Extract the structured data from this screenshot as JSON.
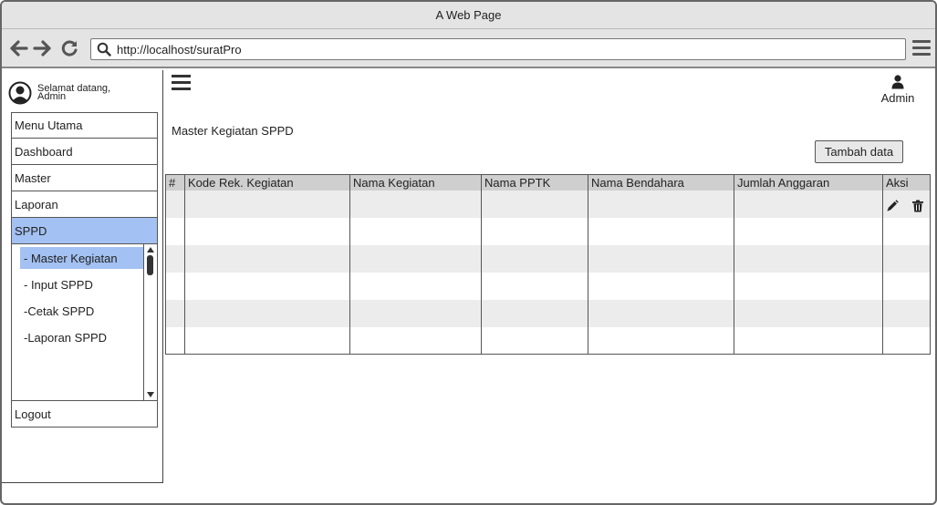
{
  "window": {
    "title": "A Web Page"
  },
  "browser": {
    "url": "http://localhost/suratPro"
  },
  "sidebar": {
    "welcome_line1": "Selamat datang,",
    "welcome_line2": "Admin",
    "items": [
      {
        "label": "Menu Utama"
      },
      {
        "label": "Dashboard"
      },
      {
        "label": "Master"
      },
      {
        "label": "Laporan"
      },
      {
        "label": "SPPD"
      }
    ],
    "submenu": [
      {
        "label": "- Master Kegiatan"
      },
      {
        "label": "- Input SPPD"
      },
      {
        "label": "-Cetak SPPD"
      },
      {
        "label": "-Laporan SPPD"
      }
    ],
    "logout": "Logout",
    "active_color": "#a3c1f2"
  },
  "header": {
    "user_label": "Admin"
  },
  "main": {
    "title": "Master Kegiatan SPPD",
    "add_button": "Tambah data",
    "table": {
      "columns": [
        "#",
        "Kode Rek. Kegiatan",
        "Nama Kegiatan",
        "Nama PPTK",
        "Nama Bendahara",
        "Jumlah Anggaran",
        "Aksi"
      ]
    }
  },
  "icons": {
    "back": "arrow-left-icon",
    "forward": "arrow-right-icon",
    "reload": "reload-icon",
    "search": "search-icon",
    "browser_menu": "hamburger-menu-icon",
    "sidebar_toggle": "hamburger-menu-icon",
    "avatar": "user-circle-icon",
    "user": "user-icon",
    "edit": "pencil-icon",
    "delete": "trash-icon"
  }
}
